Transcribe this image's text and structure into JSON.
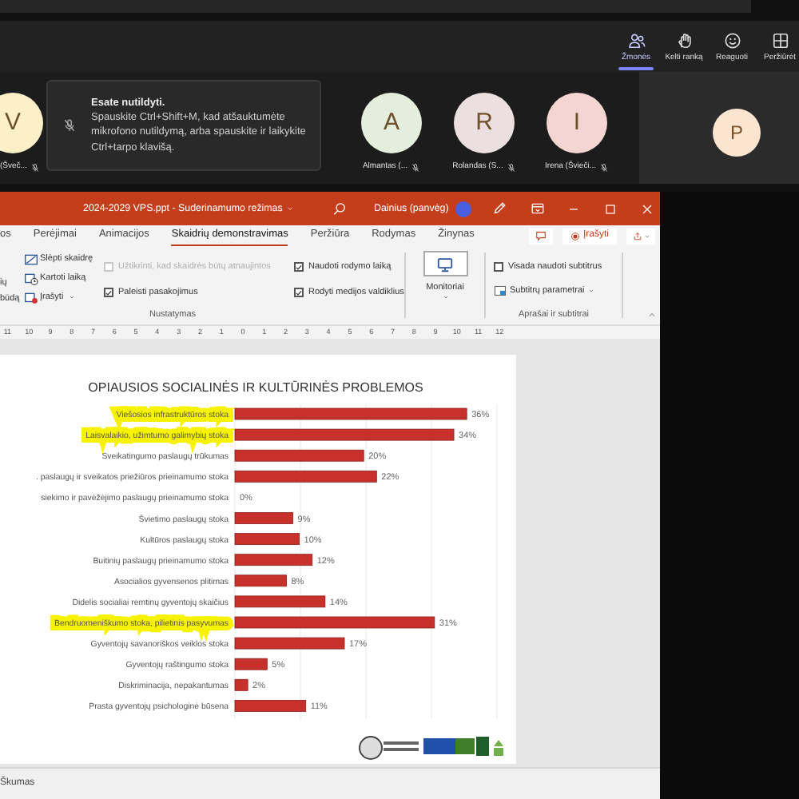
{
  "teams_toolbar": {
    "buttons": [
      {
        "label": "Žmonės",
        "kind": "people",
        "selected": true
      },
      {
        "label": "Kelti ranką",
        "kind": "hand",
        "selected": false
      },
      {
        "label": "Reaguoti",
        "kind": "smile",
        "selected": false
      },
      {
        "label": "Peržiūrėt",
        "kind": "grid",
        "selected": false
      }
    ]
  },
  "participants": [
    {
      "initial": "V",
      "name": "(Šveč...",
      "color": "#fdf0c8"
    },
    {
      "initial": "A",
      "name": "Almantas (...",
      "color": "#e3eedd"
    },
    {
      "initial": "R",
      "name": "Rolandas (S...",
      "color": "#ecdfdf"
    },
    {
      "initial": "I",
      "name": "Irena (Švieči...",
      "color": "#f4d5d2"
    }
  ],
  "tooltip": {
    "title": "Esate nutildyti.",
    "text": "Spauskite Ctrl+Shift+M, kad atšauktumėte mikrofono nutildymą, arba spauskite ir laikykite Ctrl+tarpo klavišą."
  },
  "side_tile": {
    "initial": "P",
    "color": "#fbe5d0"
  },
  "powerpoint": {
    "title": "2024-2029 VPS.ppt - Suderinamumo režimas",
    "user": "Dainius (panvėg)",
    "tabs": [
      {
        "label": "os",
        "selected": false
      },
      {
        "label": "Perėjimai",
        "selected": false
      },
      {
        "label": "Animacijos",
        "selected": false
      },
      {
        "label": "Skaidrių demonstravimas",
        "selected": true
      },
      {
        "label": "Peržiūra",
        "selected": false
      },
      {
        "label": "Rodymas",
        "selected": false
      },
      {
        "label": "Žinynas",
        "selected": false
      }
    ],
    "record_button": "Įrašyti",
    "ribbon": {
      "cut_labels": [
        "ių",
        "būdą"
      ],
      "commands": [
        {
          "label": "Slėpti skaidrę",
          "kind": "hide"
        },
        {
          "label": "Kartoti laiką",
          "kind": "rehearse"
        },
        {
          "label": "Įrašyti",
          "kind": "record"
        }
      ],
      "checkboxes": [
        {
          "label": "Užtikrinti, kad skaidrės būtų atnaujintos",
          "checked": false,
          "disabled": true
        },
        {
          "label": "Paleisti pasakojimus",
          "checked": true,
          "disabled": false
        },
        {
          "label": "Naudoti rodymo laiką",
          "checked": true,
          "disabled": false
        },
        {
          "label": "Rodyti medijos valdiklius",
          "checked": true,
          "disabled": false
        }
      ],
      "setup_group_label": "Nustatymas",
      "monitors": "Monitoriai",
      "captions_checkbox": {
        "label": "Visada naudoti subtitrus",
        "checked": false
      },
      "captions_settings": "Subtitrų parametrai",
      "captions_group_label": "Aprašai ir subtitrai"
    },
    "ruler": [
      "11",
      "10",
      "9",
      "8",
      "7",
      "6",
      "5",
      "4",
      "3",
      "2",
      "1",
      "0",
      "1",
      "2",
      "3",
      "4",
      "5",
      "6",
      "7",
      "8",
      "9",
      "10",
      "11",
      "12"
    ],
    "slide": {
      "chart_data": {
        "type": "bar",
        "orientation": "horizontal",
        "title": "OPIAUSIOS SOCIALINĖS IR KULTŪRINĖS PROBLEMOS",
        "categories": [
          "Viešosios infrastruktūros stoka",
          "Laisvalaikio, užimtumo galimybių stoka",
          "Sveikatingumo paslaugų trūkumas",
          ". paslaugų ir sveikatos priežiūros prieinamumo stoka",
          "siekimo ir pavėžėjimo paslaugų prieinamumo stoka",
          "Švietimo paslaugų stoka",
          "Kultūros paslaugų stoka",
          "Buitinių paslaugų prieinamumo stoka",
          "Asocialios gyvensenos plitimas",
          "Didelis socialiai remtinų gyventojų skaičius",
          "Bendruomeniškumo stoka, pilietinis pasyvumas",
          "Gyventojų savanoriškos veiklos stoka",
          "Gyventojų raštingumo stoka",
          "Diskriminacija, nepakantumas",
          "Prasta gyventojų psichologinė būsena"
        ],
        "values": [
          36,
          34,
          20,
          22,
          0,
          9,
          10,
          12,
          8,
          14,
          31,
          17,
          5,
          2,
          11
        ],
        "value_labels": [
          "36%",
          "34%",
          "20%",
          "22%",
          "0%",
          "9%",
          "10%",
          "12%",
          "8%",
          "14%",
          "31%",
          "17%",
          "5%",
          "2%",
          "11%"
        ]
      },
      "highlighted": [
        true,
        true,
        false,
        false,
        false,
        false,
        false,
        false,
        false,
        false,
        true,
        false,
        false,
        false,
        false
      ]
    },
    "status_bar": "Škumas"
  }
}
